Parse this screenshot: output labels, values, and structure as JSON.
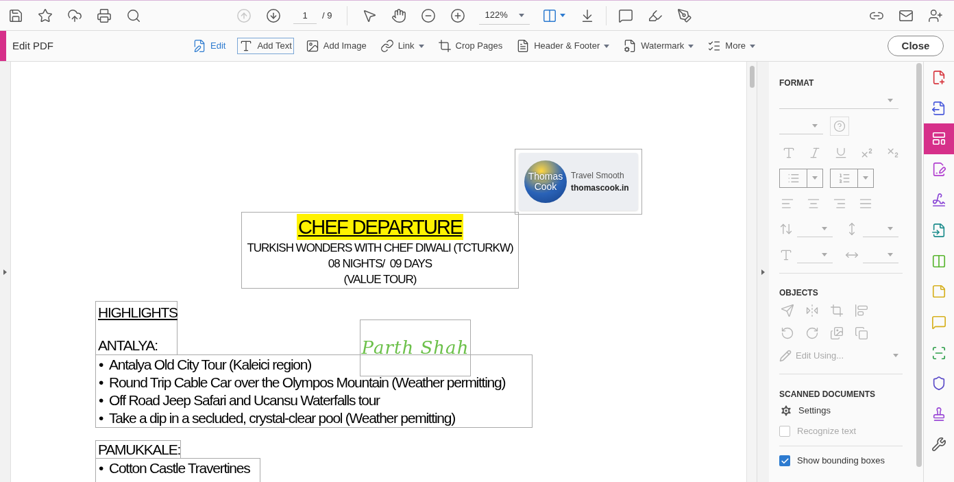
{
  "toolbar": {
    "prev_page_disabled": true,
    "page_number": "1",
    "page_total": "/ 9",
    "zoom": "122%"
  },
  "edit_bar": {
    "title": "Edit PDF",
    "close": "Close",
    "tools": [
      {
        "kind": "edit",
        "label": "Edit",
        "selected": true,
        "focused": false,
        "has_menu": false
      },
      {
        "kind": "text",
        "label": "Add Text",
        "selected": false,
        "focused": true,
        "has_menu": false
      },
      {
        "kind": "image",
        "label": "Add Image",
        "selected": false,
        "focused": false,
        "has_menu": false
      },
      {
        "kind": "link",
        "label": "Link",
        "selected": false,
        "focused": false,
        "has_menu": true
      },
      {
        "kind": "crop",
        "label": "Crop Pages",
        "selected": false,
        "focused": false,
        "has_menu": false
      },
      {
        "kind": "header",
        "label": "Header & Footer",
        "selected": false,
        "focused": false,
        "has_menu": true
      },
      {
        "kind": "watermark",
        "label": "Watermark",
        "selected": false,
        "focused": false,
        "has_menu": true
      },
      {
        "kind": "more",
        "label": "More",
        "selected": false,
        "focused": false,
        "has_menu": true
      }
    ]
  },
  "document": {
    "bullet": "•",
    "logo": {
      "brand_lines": [
        "Thomas",
        "Cook"
      ],
      "tagline": "Travel Smooth",
      "site": "thomascook.in"
    },
    "title": {
      "heading": "CHEF DEPARTURE",
      "lines": [
        "TURKISH WONDERS WITH CHEF DIWALI (TCTURKW)",
        "08 NIGHTS/  09 DAYS",
        "(VALUE TOUR)"
      ]
    },
    "highlights": {
      "heading": "HIGHLIGHTS",
      "place": "ANTALYA:"
    },
    "signature": "Parth Shah",
    "antalya_items": [
      "Antalya Old City Tour (Kaleici region)",
      "Round Trip Cable Car over the Olympos Mountain (Weather permitting)",
      "Off Road Jeep Safari and Ucansu Waterfalls tour",
      "Take a dip in a secluded, crystal-clear pool (Weather pemitting)"
    ],
    "pamukkale": {
      "heading": "PAMUKKALE:",
      "items": [
        "Cotton Castle Travertines"
      ]
    }
  },
  "format_panel": {
    "format": {
      "heading": "FORMAT"
    },
    "objects": {
      "heading": "OBJECTS",
      "edit_using": "Edit Using..."
    },
    "scanned": {
      "heading": "SCANNED DOCUMENTS",
      "settings": "Settings",
      "options": [
        {
          "label": "Recognize text",
          "checked": false,
          "disabled": true
        },
        {
          "label": "Show bounding boxes",
          "checked": true,
          "disabled": false
        }
      ]
    }
  },
  "tool_rail": [
    {
      "kind": "doc-plus",
      "color": "#d7373f",
      "selected": false
    },
    {
      "kind": "doc-export",
      "color": "#4b5bdc",
      "selected": false
    },
    {
      "kind": "layout",
      "color": "#d6308a",
      "selected": true
    },
    {
      "kind": "doc-form",
      "color": "#b13fd0",
      "selected": false
    },
    {
      "kind": "sign",
      "color": "#8a45d6",
      "selected": false
    },
    {
      "kind": "doc-arrow",
      "color": "#1c8c8c",
      "selected": false
    },
    {
      "kind": "compare",
      "color": "#58b52f",
      "selected": false
    },
    {
      "kind": "doc-note",
      "color": "#d6b01e",
      "selected": false
    },
    {
      "kind": "comment",
      "color": "#d6b01e",
      "selected": false
    },
    {
      "kind": "scan",
      "color": "#2e9e4a",
      "selected": false
    },
    {
      "kind": "shield",
      "color": "#5b4bc8",
      "selected": false
    },
    {
      "kind": "stamp",
      "color": "#9b4bd6",
      "selected": false
    },
    {
      "kind": "wrench",
      "color": "#555555",
      "selected": false
    }
  ]
}
